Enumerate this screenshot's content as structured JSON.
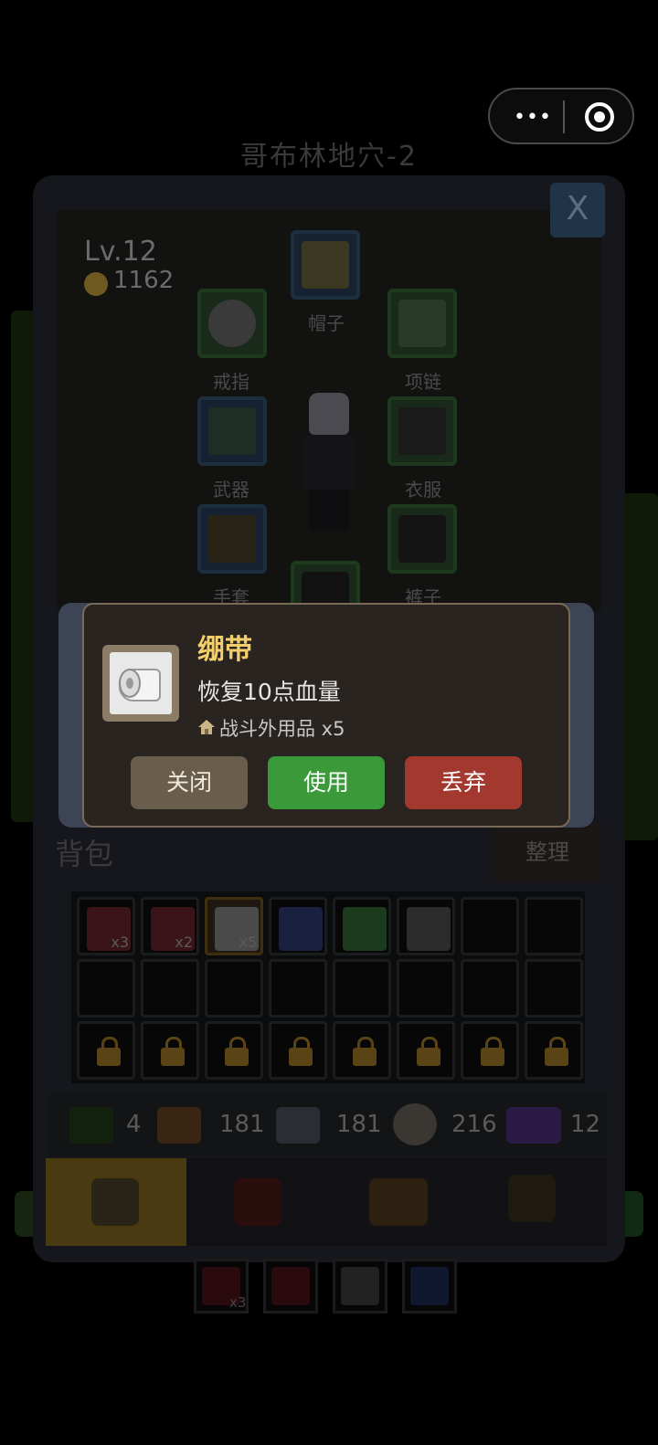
{
  "map_title": "哥布林地穴-2",
  "capsule": {
    "more": "•••",
    "record_icon": "record-icon"
  },
  "panel": {
    "close_label": "X",
    "level": "Lv.12",
    "gold": "1162",
    "slots": {
      "hat": "帽子",
      "ring": "戒指",
      "necklace": "项链",
      "weapon": "武器",
      "clothes": "衣服",
      "gloves": "手套",
      "pants": "裤子"
    }
  },
  "bag": {
    "title": "背包",
    "sort_label": "整理",
    "row1": [
      {
        "icon": "red-potion",
        "qty": "x3"
      },
      {
        "icon": "red-potion",
        "qty": "x2"
      },
      {
        "icon": "bandage",
        "qty": "x5"
      },
      {
        "icon": "blue-potion",
        "qty": ""
      },
      {
        "icon": "green-gem",
        "qty": ""
      },
      {
        "icon": "skull-mask",
        "qty": ""
      },
      {
        "icon": "",
        "qty": ""
      },
      {
        "icon": "",
        "qty": ""
      }
    ]
  },
  "resources": [
    {
      "icon": "herb-icon",
      "value": "4"
    },
    {
      "icon": "wood-log-icon",
      "value": "181"
    },
    {
      "icon": "ore-icon",
      "value": "181"
    },
    {
      "icon": "yarn-icon",
      "value": "216"
    },
    {
      "icon": "portal-icon",
      "value": "12"
    }
  ],
  "quick_bar": {
    "first_qty": "x3"
  },
  "modal": {
    "name": "绷带",
    "description": "恢复10点血量",
    "type": "战斗外用品 x5",
    "close_label": "关闭",
    "use_label": "使用",
    "drop_label": "丢弃"
  },
  "colors": {
    "item_name": "#f2cf6a",
    "use_button": "#3a9a3a",
    "drop_button": "#a3382e",
    "close_button": "#695d4c"
  }
}
